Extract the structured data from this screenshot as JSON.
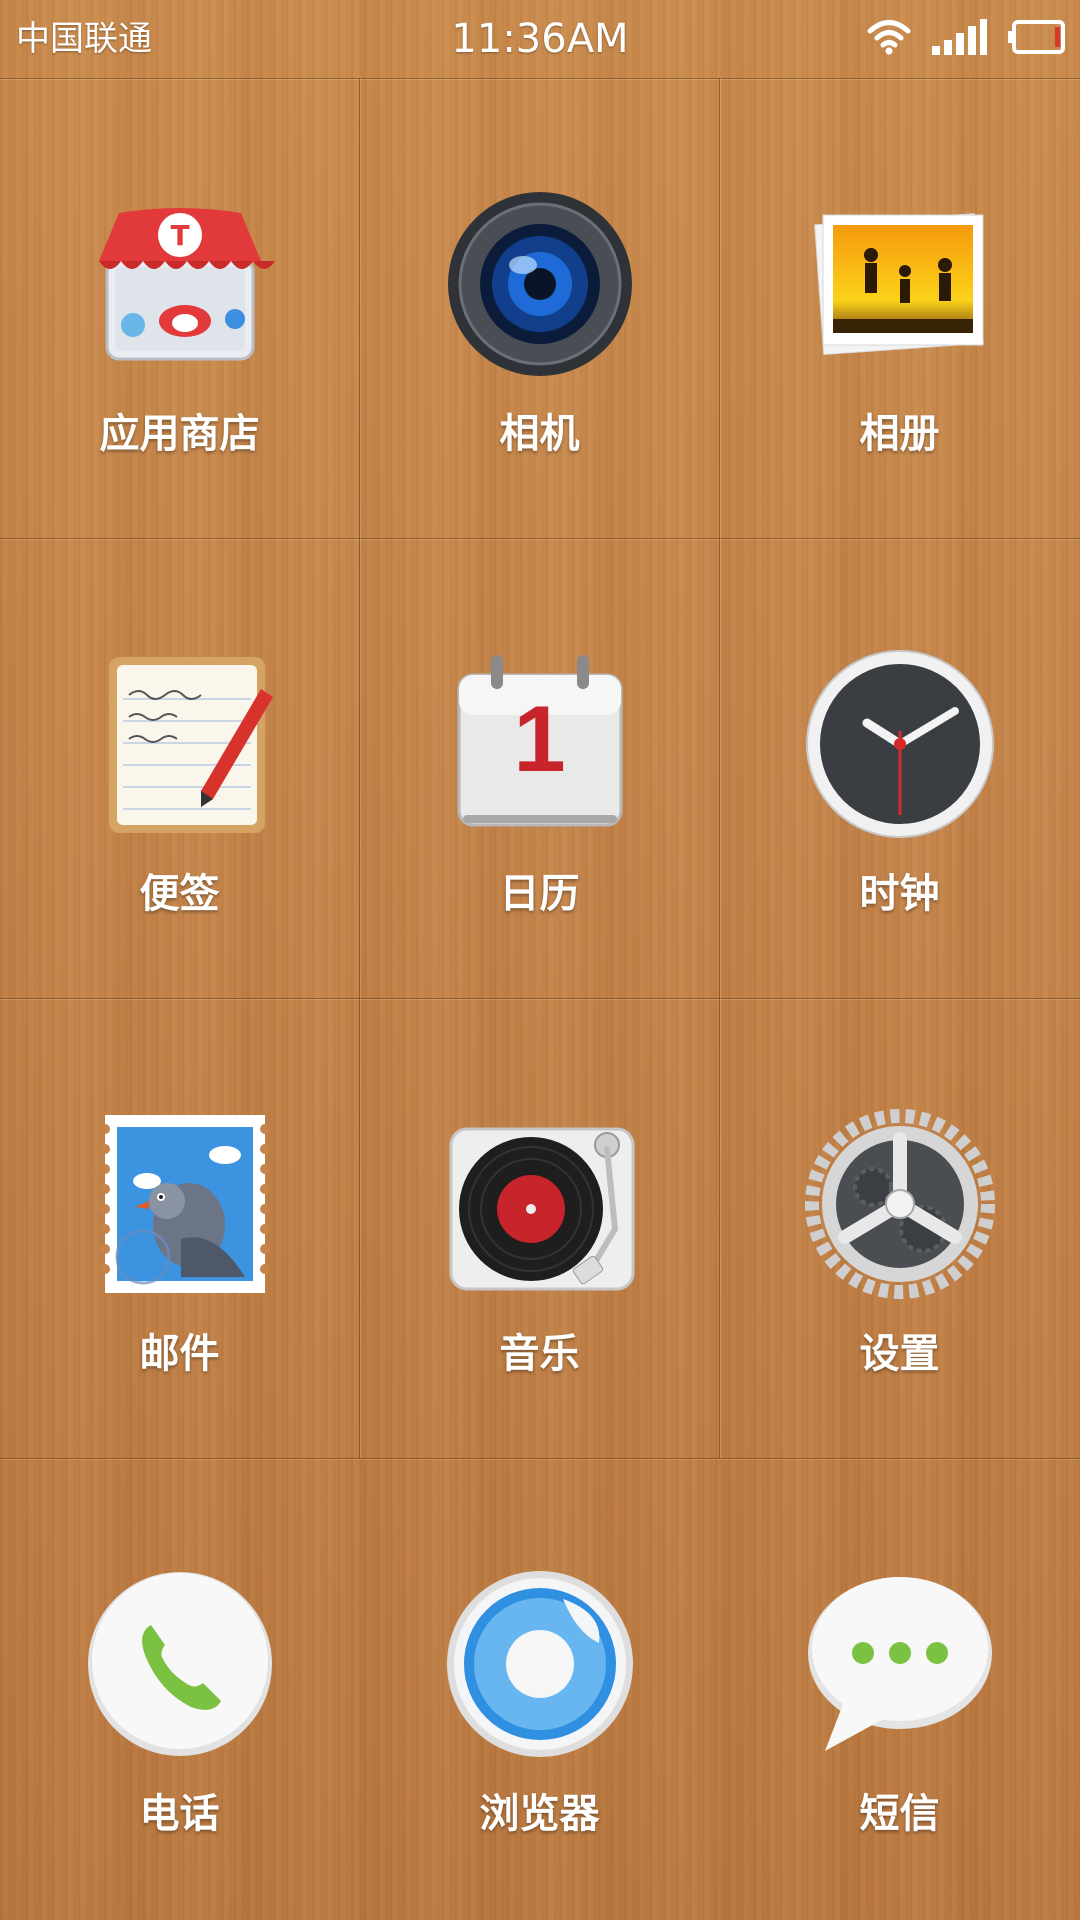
{
  "status": {
    "carrier": "中国联通",
    "time": "11:36AM",
    "icons": [
      "wifi-icon",
      "signal-icon",
      "battery-icon"
    ]
  },
  "apps": [
    {
      "label": "应用商店",
      "icon": "app-store-icon"
    },
    {
      "label": "相机",
      "icon": "camera-icon"
    },
    {
      "label": "相册",
      "icon": "photo-album-icon"
    },
    {
      "label": "便签",
      "icon": "notes-icon"
    },
    {
      "label": "日历",
      "icon": "calendar-icon",
      "date": "1"
    },
    {
      "label": "时钟",
      "icon": "clock-icon"
    },
    {
      "label": "邮件",
      "icon": "mail-icon"
    },
    {
      "label": "音乐",
      "icon": "music-icon"
    },
    {
      "label": "设置",
      "icon": "settings-icon"
    }
  ],
  "dock": [
    {
      "label": "电话",
      "icon": "phone-icon"
    },
    {
      "label": "浏览器",
      "icon": "browser-icon"
    },
    {
      "label": "短信",
      "icon": "messages-icon"
    }
  ],
  "colors": {
    "store_red": "#e23a3a",
    "calendar_red": "#c8242b",
    "sms_green": "#7cc242",
    "browser_blue": "#2f8fe0"
  }
}
